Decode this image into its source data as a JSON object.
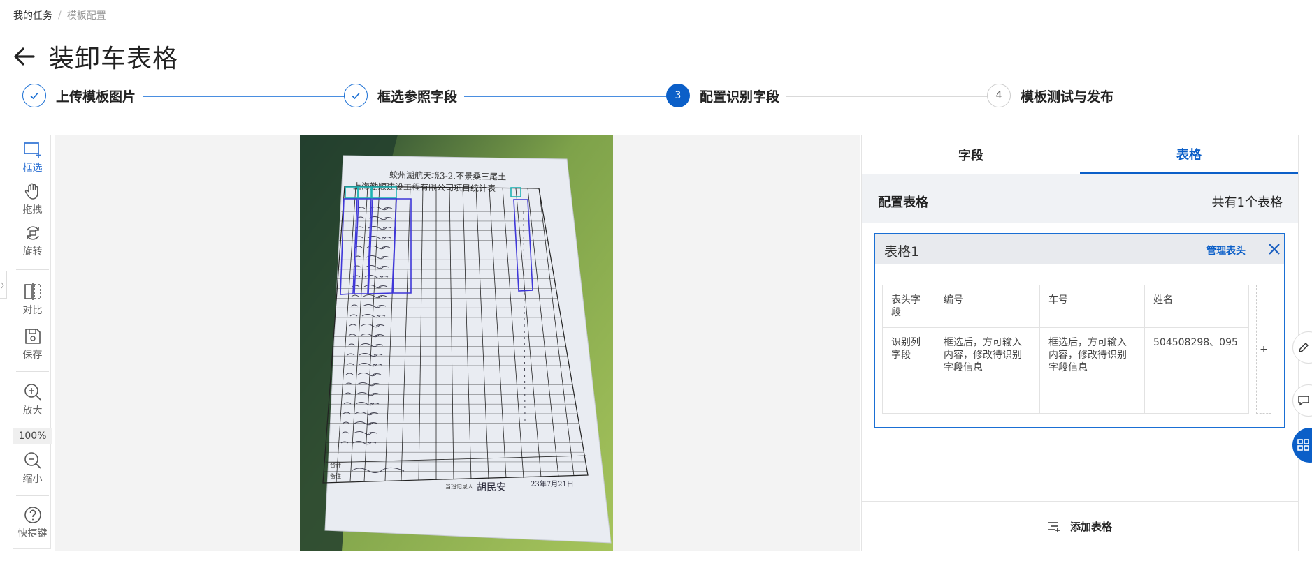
{
  "breadcrumb": {
    "parent": "我的任务",
    "separator": "/",
    "current": "模板配置"
  },
  "page": {
    "title": "装卸车表格"
  },
  "steps": [
    {
      "label": "上传模板图片",
      "state": "done"
    },
    {
      "label": "框选参照字段",
      "state": "done"
    },
    {
      "label": "配置识别字段",
      "state": "active",
      "number": "3"
    },
    {
      "label": "模板测试与发布",
      "state": "todo",
      "number": "4"
    }
  ],
  "toolbar": {
    "select": "框选",
    "drag": "拖拽",
    "rotate": "旋转",
    "compare": "对比",
    "save": "保存",
    "zoom_in": "放大",
    "zoom_level": "100%",
    "zoom_out": "缩小",
    "shortcuts": "快捷键"
  },
  "panel": {
    "tabs": [
      "字段",
      "表格"
    ],
    "active_tab": "表格",
    "config_title": "配置表格",
    "table_count": "共有1个表格",
    "add_table": "添加表格"
  },
  "table_card": {
    "title": "表格1",
    "manage": "管理表头",
    "header_row_label": "表头字段",
    "field_row_label": "识别列字段",
    "columns": [
      {
        "header": "编号",
        "field": "框选后，方可输入内容，修改待识别字段信息"
      },
      {
        "header": "车号",
        "field": "框选后，方可输入内容，修改待识别字段信息"
      },
      {
        "header": "姓名",
        "field": "504508298、095"
      }
    ],
    "add_column": "+"
  },
  "document": {
    "heading_line1": "蛟州湖航天境3-2.不景桑三尾土",
    "heading_line2": "上海勤顺建设工程有限公司项目统计表",
    "footer_total_label": "合计",
    "footer_note_label": "备注",
    "recorder_label": "当班记录人",
    "recorder_name": "胡民安",
    "date": "23年7月21日"
  },
  "colors": {
    "accent": "#0b5fc8",
    "line": "#1a6fd4",
    "select_box": "#3f37d8",
    "header_box": "#1fb3b3"
  }
}
